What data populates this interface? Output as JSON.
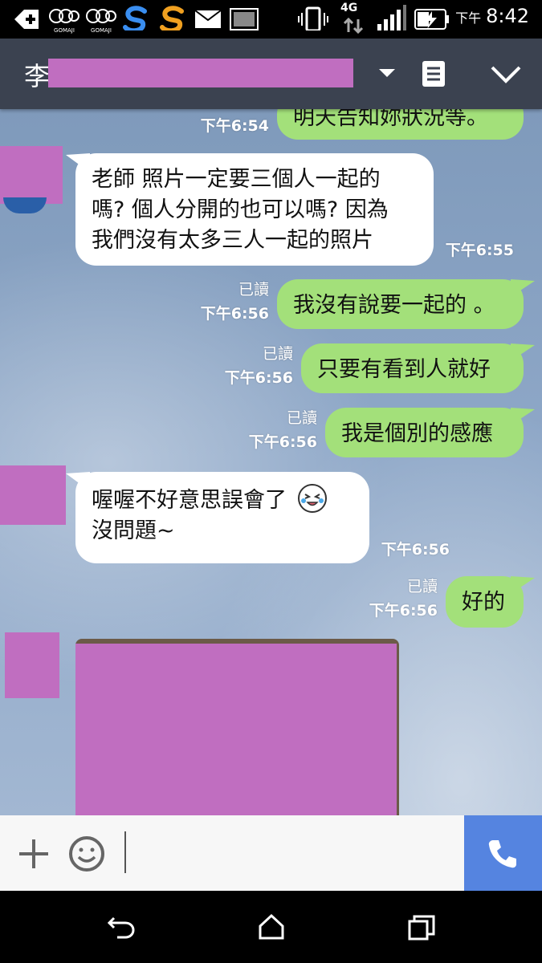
{
  "status_bar": {
    "network": "4G",
    "time_prefix": "下午",
    "time": "8:42",
    "app_icon_label_1": "GOMAJI",
    "app_icon_label_2": "GOMAJI"
  },
  "header": {
    "contact_initial": "李",
    "dropdown_icon": "caret-down-icon",
    "notes_icon": "notes-icon",
    "collapse_icon": "chevron-down-icon"
  },
  "messages": [
    {
      "dir": "out",
      "text": "明天告知妳狀況等。",
      "time": "下午6:54",
      "read": ""
    },
    {
      "dir": "in",
      "lines": [
        "老師 照片一定要三個人一起的",
        "嗎? 個人分開的也可以嗎? 因為",
        "我們沒有太多三人一起的照片"
      ],
      "time": "下午6:55"
    },
    {
      "dir": "out",
      "text": "我沒有說要一起的 。",
      "time": "下午6:56",
      "read": "已讀"
    },
    {
      "dir": "out",
      "text": "只要有看到人就好",
      "time": "下午6:56",
      "read": "已讀"
    },
    {
      "dir": "out",
      "text": "我是個別的感應",
      "time": "下午6:56",
      "read": "已讀"
    },
    {
      "dir": "in",
      "lines": [
        "喔喔不好意思誤會了",
        "沒問題~"
      ],
      "time": "下午6:56"
    },
    {
      "dir": "out",
      "text": "好的",
      "time": "下午6:56",
      "read": "已讀"
    }
  ],
  "input": {
    "add_icon": "plus-icon",
    "emoji_icon": "smiley-icon",
    "call_icon": "phone-icon",
    "value": ""
  },
  "colors": {
    "outgoing_bubble": "#a3e07a",
    "incoming_bubble": "#ffffff",
    "header_bg": "#3b4250",
    "call_button": "#5584e0",
    "redaction": "#c06ec0"
  }
}
